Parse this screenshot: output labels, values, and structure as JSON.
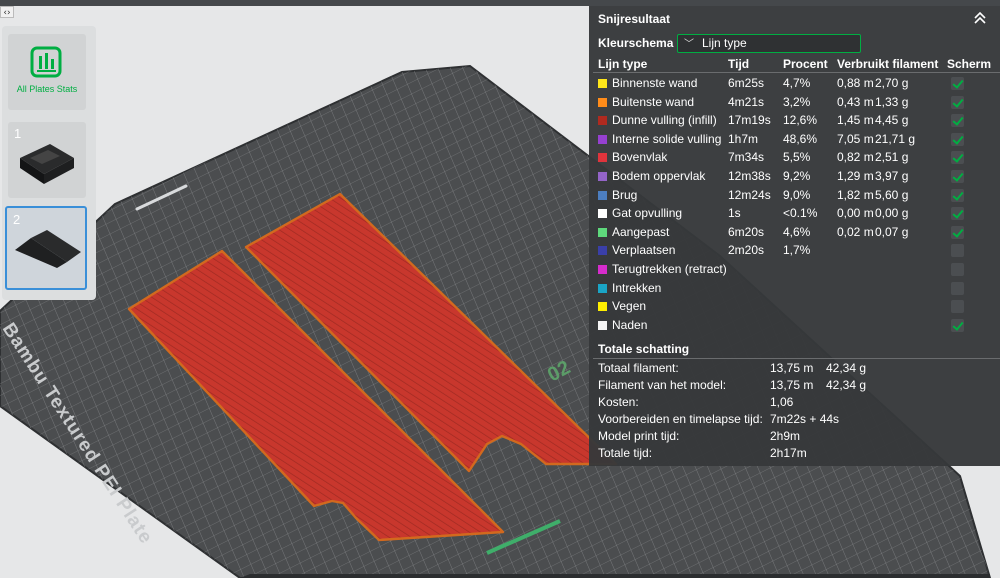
{
  "plates": {
    "all_label": "All Plates Stats",
    "items": [
      {
        "number": "1"
      },
      {
        "number": "2"
      }
    ]
  },
  "bed": {
    "label": "Bambu Textured PEI Plate",
    "plate_number": "02"
  },
  "panel": {
    "title": "Snijresultaat",
    "color_scheme_label": "Kleurschema",
    "color_scheme_value": "Lijn type",
    "headers": {
      "line_type": "Lijn type",
      "time": "Tijd",
      "percent": "Procent",
      "filament": "Verbruikt filament",
      "display": "Scherm"
    },
    "rows": [
      {
        "name": "Binnenste wand",
        "color": "#ffe61a",
        "time": "6m25s",
        "percent": "4,7%",
        "length": "0,88 m",
        "weight": "2,70 g",
        "checked": true
      },
      {
        "name": "Buitenste wand",
        "color": "#ff8c1a",
        "time": "4m21s",
        "percent": "3,2%",
        "length": "0,43 m",
        "weight": "1,33 g",
        "checked": true
      },
      {
        "name": "Dunne vulling (infill)",
        "color": "#b02a1f",
        "time": "17m19s",
        "percent": "12,6%",
        "length": "1,45 m",
        "weight": "4,45 g",
        "checked": true
      },
      {
        "name": "Interne solide vulling",
        "color": "#9640d0",
        "time": "1h7m",
        "percent": "48,6%",
        "length": "7,05 m",
        "weight": "21,71 g",
        "checked": true
      },
      {
        "name": "Bovenvlak",
        "color": "#e0343c",
        "time": "7m34s",
        "percent": "5,5%",
        "length": "0,82 m",
        "weight": "2,51 g",
        "checked": true
      },
      {
        "name": "Bodem oppervlak",
        "color": "#9464c8",
        "time": "12m38s",
        "percent": "9,2%",
        "length": "1,29 m",
        "weight": "3,97 g",
        "checked": true
      },
      {
        "name": "Brug",
        "color": "#4c7ec0",
        "time": "12m24s",
        "percent": "9,0%",
        "length": "1,82 m",
        "weight": "5,60 g",
        "checked": true
      },
      {
        "name": "Gat opvulling",
        "color": "#ffffff",
        "time": "1s",
        "percent": "<0.1%",
        "length": "0,00 m",
        "weight": "0,00 g",
        "checked": true
      },
      {
        "name": "Aangepast",
        "color": "#5ed87c",
        "time": "6m20s",
        "percent": "4,6%",
        "length": "0,02 m",
        "weight": "0,07 g",
        "checked": true
      },
      {
        "name": "Verplaatsen",
        "color": "#3a3fa8",
        "time": "2m20s",
        "percent": "1,7%",
        "length": "",
        "weight": "",
        "checked": false
      },
      {
        "name": "Terugtrekken (retract)",
        "color": "#d62ccc",
        "time": "",
        "percent": "",
        "length": "",
        "weight": "",
        "checked": false
      },
      {
        "name": "Intrekken",
        "color": "#1aa5c6",
        "time": "",
        "percent": "",
        "length": "",
        "weight": "",
        "checked": false
      },
      {
        "name": "Vegen",
        "color": "#ffee00",
        "time": "",
        "percent": "",
        "length": "",
        "weight": "",
        "checked": false
      },
      {
        "name": "Naden",
        "color": "#f5f5f5",
        "time": "",
        "percent": "",
        "length": "",
        "weight": "",
        "checked": true
      }
    ],
    "totals_title": "Totale schatting",
    "totals": [
      {
        "label": "Totaal filament:",
        "v1": "13,75 m",
        "v2": "42,34 g"
      },
      {
        "label": "Filament van het model:",
        "v1": "13,75 m",
        "v2": "42,34 g"
      },
      {
        "label": "Kosten:",
        "v1": "1,06",
        "v2": ""
      },
      {
        "label": "Voorbereiden en timelapse tijd:",
        "v1": "7m22s + 44s",
        "v2": ""
      },
      {
        "label": "Model print tijd:",
        "v1": "2h9m",
        "v2": ""
      },
      {
        "label": "Totale tijd:",
        "v1": "2h17m",
        "v2": ""
      }
    ]
  },
  "colors": {
    "accent": "#00ae42",
    "bed": "#4b4d4f",
    "part": "#c0392b",
    "part_edge": "#d2691e"
  }
}
